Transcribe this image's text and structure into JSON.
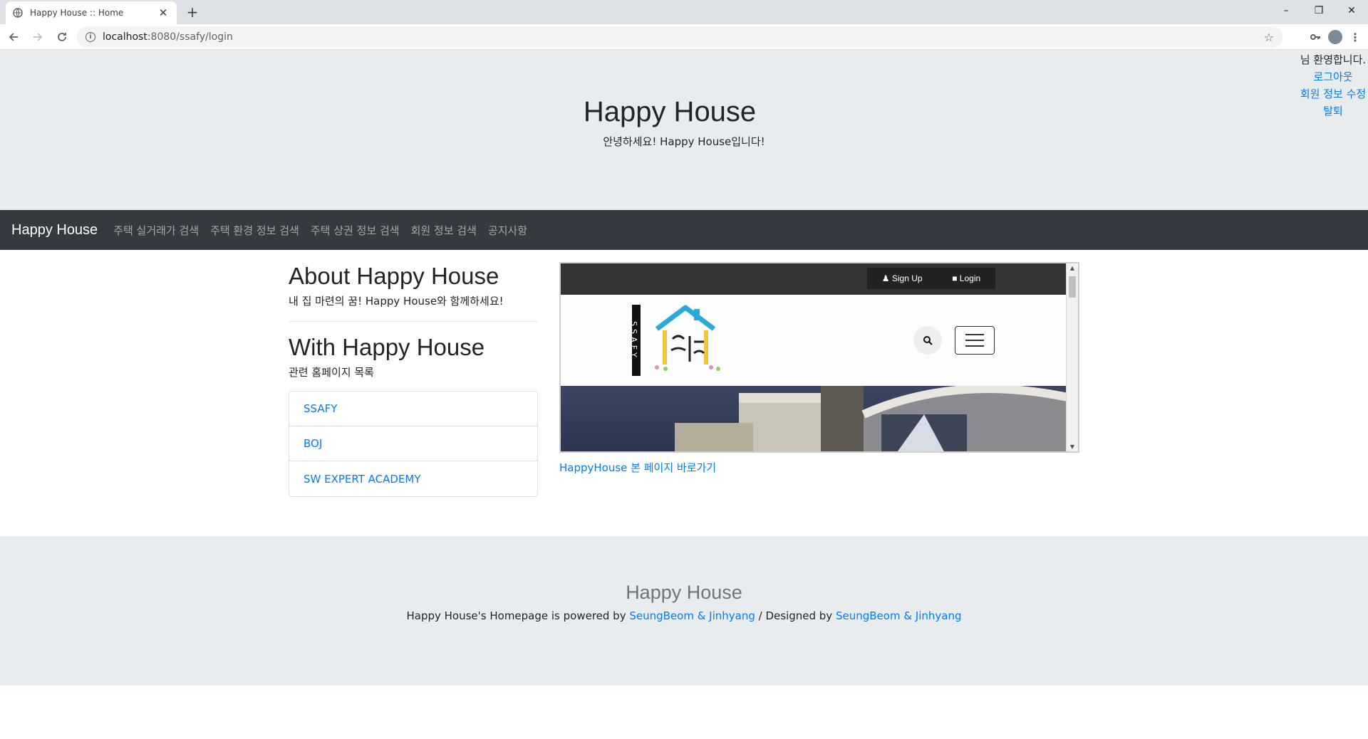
{
  "browser": {
    "tab_title": "Happy House :: Home",
    "url_host": "localhost",
    "url_rest": ":8080/ssafy/login",
    "new_tab": "+",
    "minimize": "–",
    "restore": "❐",
    "close": "✕"
  },
  "header": {
    "title": "Happy House",
    "subtitle": "안녕하세요! Happy House입니다!"
  },
  "user_menu": {
    "greeting": "님 환영합니다.",
    "logout": "로그아웃",
    "edit_profile": "회원 정보 수정",
    "withdraw": "탈퇴"
  },
  "navbar": {
    "brand": "Happy House",
    "links": [
      "주택 실거래가 검색",
      "주택 환경 정보 검색",
      "주택 상권 정보 검색",
      "회원 정보 검색",
      "공지사항"
    ]
  },
  "about": {
    "title": "About Happy House",
    "subtitle": "내 집 마련의 꿈! Happy House와 함께하세요!"
  },
  "with": {
    "title": "With Happy House",
    "subtitle": "관련 홈페이지 목록",
    "links": [
      "SSAFY",
      "BOJ",
      "SW EXPERT ACADEMY"
    ]
  },
  "embed": {
    "sign_up": "Sign Up",
    "login": "Login",
    "logo_bar_text": "SSAFY",
    "shortcut": "HappyHouse 본 페이지 바로가기"
  },
  "footer": {
    "title": "Happy House",
    "text_before": "Happy House's Homepage is powered by ",
    "author1": "SeungBeom & Jinhyang",
    "text_middle": " / Designed by ",
    "author2": "SeungBeom & Jinhyang"
  },
  "colors": {
    "link": "#007bff",
    "navbar_bg": "#343a40",
    "jumbotron_bg": "#e9ecef"
  }
}
